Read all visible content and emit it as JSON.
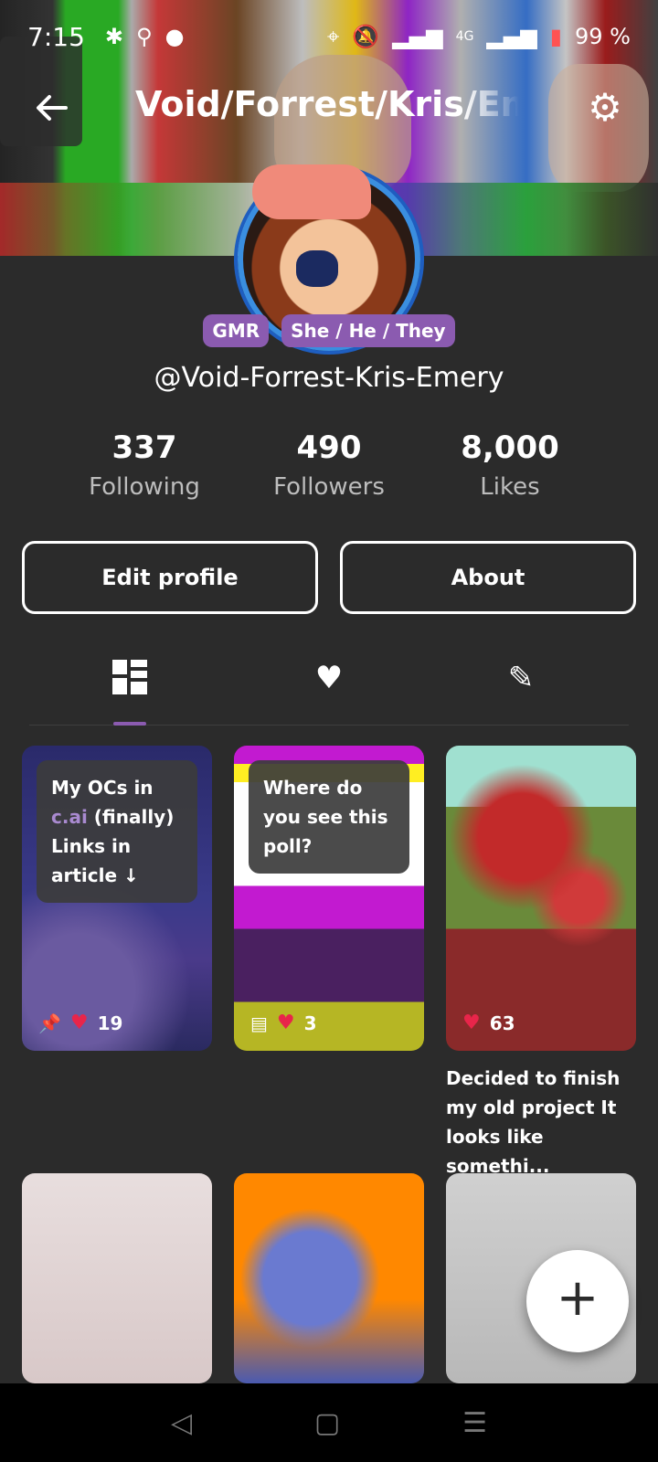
{
  "status_bar": {
    "time": "7:15",
    "battery": "99 %",
    "network": "4G"
  },
  "header": {
    "title": "Void/Forrest/Kris/Eme",
    "back_icon": "arrow-left-icon",
    "settings_icon": "gear-icon"
  },
  "profile": {
    "badges": [
      "GMR",
      "She / He / They"
    ],
    "username": "@Void-Forrest-Kris-Emery",
    "stats": [
      {
        "value": "337",
        "label": "Following"
      },
      {
        "value": "490",
        "label": "Followers"
      },
      {
        "value": "8,000",
        "label": "Likes"
      }
    ],
    "buttons": {
      "edit": "Edit profile",
      "about": "About"
    }
  },
  "tabs": [
    {
      "icon": "grid-icon",
      "active": true
    },
    {
      "icon": "heart-icon",
      "active": false
    },
    {
      "icon": "pencil-icon",
      "active": false
    }
  ],
  "posts": [
    {
      "text_pre": "My OCs in ",
      "highlight": "c.ai",
      "text_post": " (finally) Links in article ↓",
      "likes": "19",
      "pinned": true
    },
    {
      "text": "Where do you see this poll?",
      "likes": "3",
      "poll": true
    },
    {
      "likes": "63",
      "caption": "Decided to finish my old project It looks like somethi..."
    }
  ],
  "colors": {
    "accent": "#8b5bb0",
    "background": "#2b2b2b",
    "heart": "#e8254a"
  }
}
